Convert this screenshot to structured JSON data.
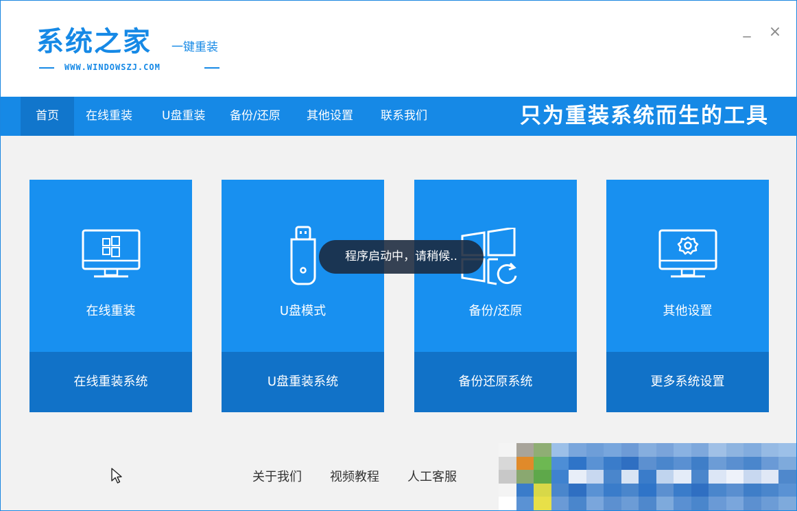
{
  "header": {
    "logo_text": "系统之家",
    "logo_sub": "一键重装",
    "logo_url": "WWW.WINDOWSZJ.COM",
    "minimize_label": "_",
    "close_label": "×"
  },
  "nav": {
    "items": [
      "首页",
      "在线重装",
      "U盘重装",
      "备份/还原",
      "其他设置",
      "联系我们"
    ],
    "active": "首页",
    "slogan": "只为重装系统而生的工具"
  },
  "cards": [
    {
      "title": "在线重装",
      "footer": "在线重装系统",
      "icon": "monitor-windows-icon"
    },
    {
      "title": "U盘模式",
      "footer": "U盘重装系统",
      "icon": "usb-drive-icon"
    },
    {
      "title": "备份/还原",
      "footer": "备份还原系统",
      "icon": "windows-restore-icon"
    },
    {
      "title": "其他设置",
      "footer": "更多系统设置",
      "icon": "monitor-gear-icon"
    }
  ],
  "toast": {
    "message": "程序启动中，请稍候.."
  },
  "footer": {
    "links": [
      "关于我们",
      "视频教程",
      "人工客服"
    ]
  },
  "colors": {
    "brand_blue": "#1689e6",
    "card_blue": "#1890f0",
    "card_footer_blue": "#1172c8",
    "nav_active": "#1176cc",
    "background": "#f2f2f2"
  }
}
